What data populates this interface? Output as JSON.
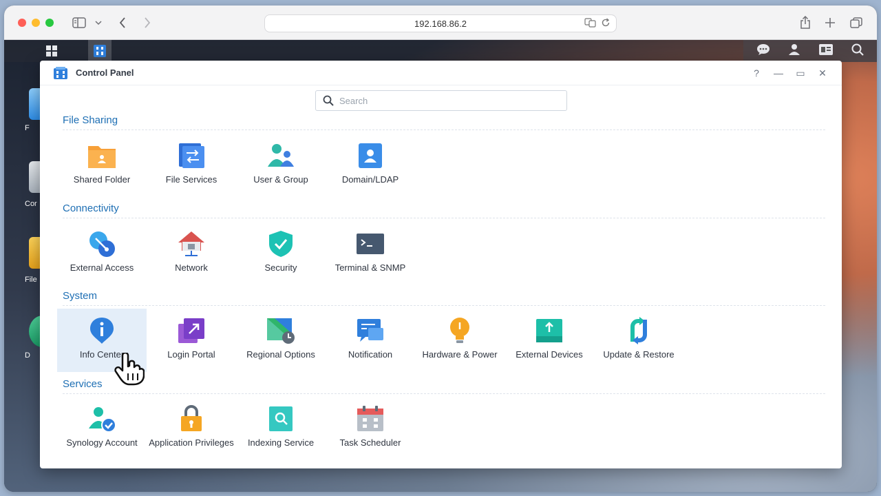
{
  "browser": {
    "address": "192.168.86.2",
    "icons": [
      "sidebar-icon",
      "chevron-down-icon",
      "back-icon",
      "forward-icon",
      "translate-icon",
      "reload-icon",
      "share-icon",
      "new-tab-icon",
      "tabs-overview-icon"
    ]
  },
  "desktop": {
    "labels": [
      "F",
      "Cor",
      "File",
      "D"
    ]
  },
  "window": {
    "title": "Control Panel",
    "controls": [
      "?",
      "—",
      "▭",
      "✕"
    ]
  },
  "search": {
    "placeholder": "Search"
  },
  "sections": [
    {
      "title": "File Sharing",
      "items": [
        {
          "label": "Shared Folder",
          "icon": "shared-folder-icon"
        },
        {
          "label": "File Services",
          "icon": "file-services-icon"
        },
        {
          "label": "User & Group",
          "icon": "user-group-icon"
        },
        {
          "label": "Domain/LDAP",
          "icon": "domain-ldap-icon"
        }
      ]
    },
    {
      "title": "Connectivity",
      "items": [
        {
          "label": "External Access",
          "icon": "external-access-icon"
        },
        {
          "label": "Network",
          "icon": "network-icon"
        },
        {
          "label": "Security",
          "icon": "security-shield-icon"
        },
        {
          "label": "Terminal & SNMP",
          "icon": "terminal-icon"
        }
      ]
    },
    {
      "title": "System",
      "items": [
        {
          "label": "Info Center",
          "icon": "info-center-icon"
        },
        {
          "label": "Login Portal",
          "icon": "login-portal-icon"
        },
        {
          "label": "Regional Options",
          "icon": "regional-options-icon"
        },
        {
          "label": "Notification",
          "icon": "notification-icon"
        },
        {
          "label": "Hardware & Power",
          "icon": "hardware-power-icon"
        },
        {
          "label": "External Devices",
          "icon": "external-devices-icon"
        },
        {
          "label": "Update & Restore",
          "icon": "update-restore-icon"
        }
      ]
    },
    {
      "title": "Services",
      "items": [
        {
          "label": "Synology Account",
          "icon": "synology-account-icon"
        },
        {
          "label": "Application Privileges",
          "icon": "application-privileges-icon"
        },
        {
          "label": "Indexing Service",
          "icon": "indexing-service-icon"
        },
        {
          "label": "Task Scheduler",
          "icon": "task-scheduler-icon"
        }
      ]
    }
  ],
  "selected": "Info Center",
  "colors": {
    "section_title": "#1e6fb4",
    "selection": "#e4eef9"
  }
}
